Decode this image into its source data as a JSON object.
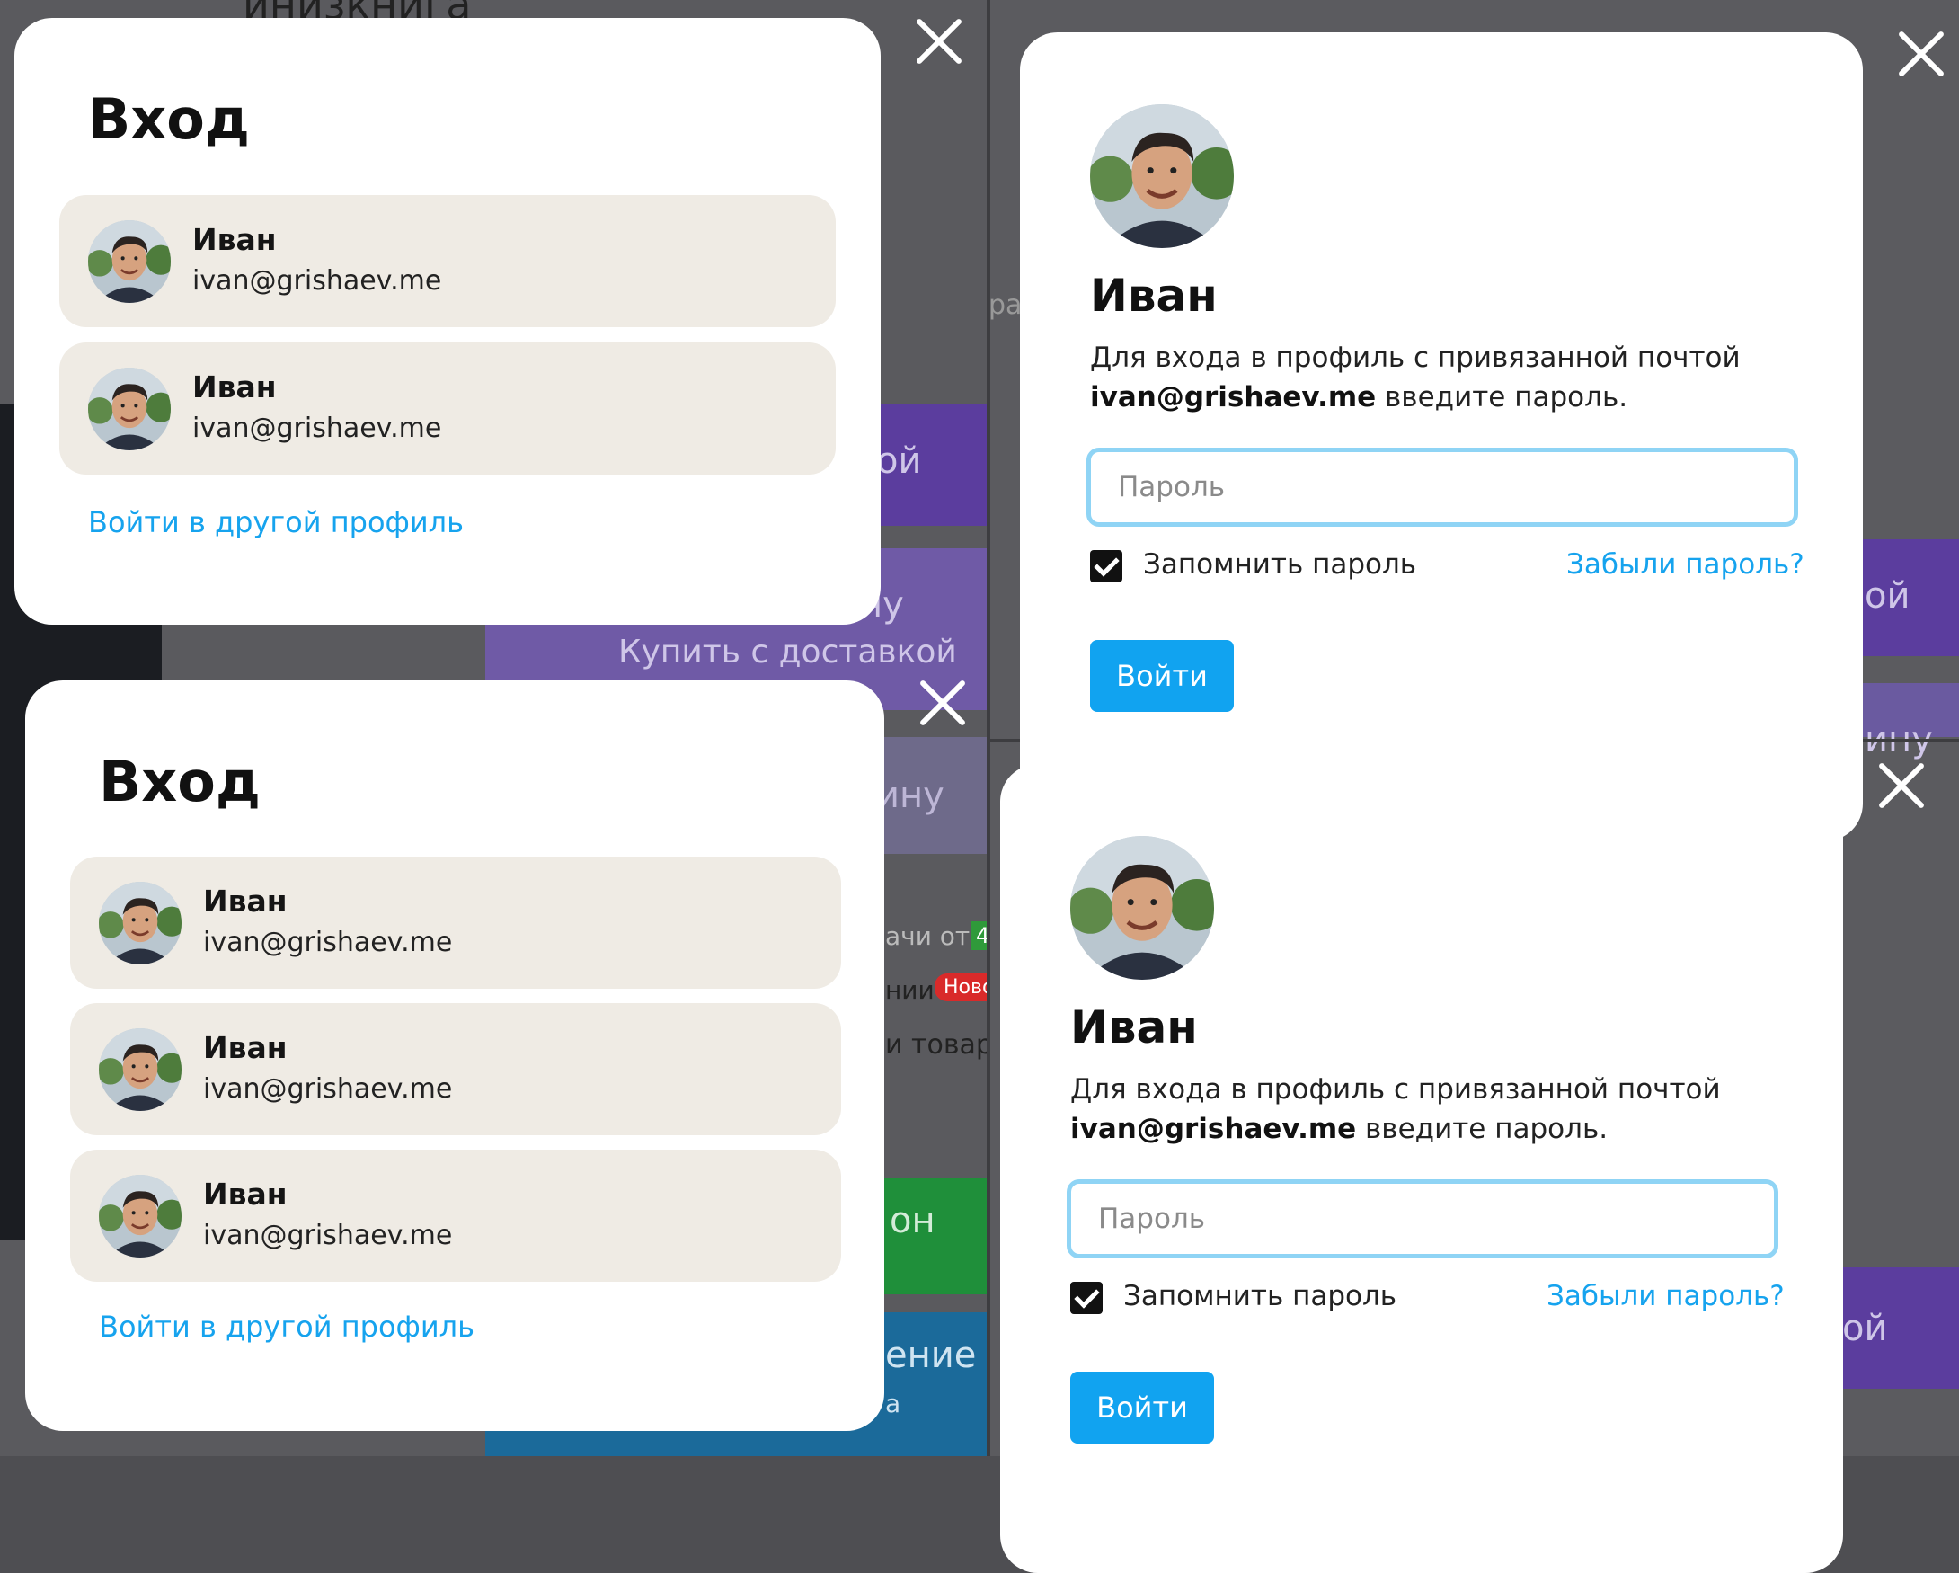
{
  "colors": {
    "accent": "#11a3f0",
    "link": "#16a3ee",
    "card_bg": "#efebe4",
    "input_border": "#8fd4f5",
    "overlay_purple": "#5b3d9e",
    "overlay_green": "#1f8f3a",
    "overlay_teal": "#1b6a9a"
  },
  "background": {
    "top_title": "инизкнига",
    "item_buy_delivery": "Купить с доставкой",
    "item_oy_1": "ой",
    "item_nu_1": "ину",
    "item_nu_2": "ину",
    "item_chi_ot": "ачи от",
    "item_chi_badge": "4",
    "item_nii": "нии",
    "item_new_badge": "Ново",
    "item_tovar": "и товар",
    "item_on": "он",
    "item_enie": "ение",
    "item_a": "а",
    "item_ra": "ра",
    "item_oy_2": "ой",
    "item_nu_3": "ину",
    "item_oy_3": "ой"
  },
  "panels": {
    "login_2": {
      "title": "Вход",
      "accounts": [
        {
          "name": "Иван",
          "email": "ivan@grishaev.me",
          "avatar": "avatar-photo-icon"
        },
        {
          "name": "Иван",
          "email": "ivan@grishaev.me",
          "avatar": "avatar-photo-icon"
        }
      ],
      "other_profile_link": "Войти в другой профиль"
    },
    "login_3": {
      "title": "Вход",
      "accounts": [
        {
          "name": "Иван",
          "email": "ivan@grishaev.me",
          "avatar": "avatar-photo-icon"
        },
        {
          "name": "Иван",
          "email": "ivan@grishaev.me",
          "avatar": "avatar-photo-icon"
        },
        {
          "name": "Иван",
          "email": "ivan@grishaev.me",
          "avatar": "avatar-photo-icon"
        }
      ],
      "other_profile_link": "Войти в другой профиль"
    },
    "password_top": {
      "name": "Иван",
      "desc_line1": "Для входа в профиль с привязанной почтой",
      "desc_email": "ivan@grishaev.me",
      "desc_tail": " введите пароль.",
      "password_placeholder": "Пароль",
      "password_value": "",
      "remember_label": "Запомнить пароль",
      "remember_checked": true,
      "forgot_link": "Забыли пароль?",
      "submit_label": "Войти"
    },
    "password_bottom": {
      "name": "Иван",
      "desc_line1": "Для входа в профиль с привязанной почтой",
      "desc_email": "ivan@grishaev.me",
      "desc_tail": " введите пароль.",
      "password_placeholder": "Пароль",
      "password_value": "",
      "remember_label": "Запомнить пароль",
      "remember_checked": true,
      "forgot_link": "Забыли пароль?",
      "submit_label": "Войти"
    }
  }
}
